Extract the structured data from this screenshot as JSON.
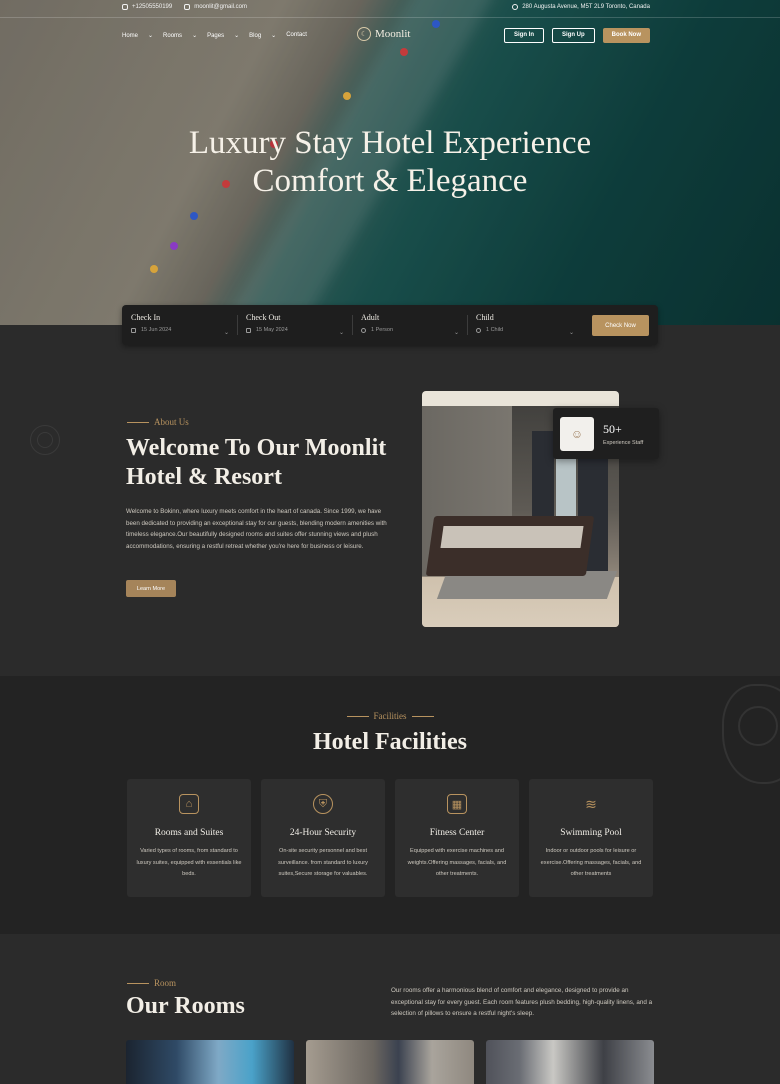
{
  "topbar": {
    "phone": "+12505550199",
    "email": "moonlit@gmail.com",
    "address": "280 Augusta Avenue, M5T 2L9 Toronto, Canada"
  },
  "nav": {
    "items": [
      "Home",
      "Rooms",
      "Pages",
      "Blog",
      "Contact"
    ],
    "logo": "Moonlit",
    "sign_in": "Sign In",
    "sign_up": "Sign Up",
    "book_now": "Book Now"
  },
  "hero": {
    "title_line1": "Luxury Stay Hotel Experience",
    "title_line2": "Comfort & Elegance"
  },
  "booking": {
    "check_in_label": "Check In",
    "check_in_value": "15 Jun 2024",
    "check_out_label": "Check Out",
    "check_out_value": "15 May 2024",
    "adult_label": "Adult",
    "adult_value": "1 Person",
    "child_label": "Child",
    "child_value": "1 Child",
    "check_now": "Check Now"
  },
  "about": {
    "kicker": "About Us",
    "title_line1": "Welcome To Our Moonlit",
    "title_line2": "Hotel & Resort",
    "text": "Welcome to Bokinn, where luxury meets comfort in the heart of canada. Since 1999, we have been dedicated to providing an exceptional stay for our guests, blending modern amenities with timeless elegance.Our beautifully designed rooms and suites offer stunning views and plush accommodations, ensuring a restful retreat whether you're here for business or leisure.",
    "learn_more": "Learn More",
    "staff_count": "50+",
    "staff_label": "Experience Staff"
  },
  "facilities": {
    "kicker": "Facilities",
    "title": "Hotel Facilities",
    "cards": [
      {
        "icon": "bed-icon",
        "title": "Rooms and Suites",
        "text": "Varied types of rooms, from standard to luxury suites, equipped with essentials like beds."
      },
      {
        "icon": "security-icon",
        "title": "24-Hour Security",
        "text": "On-site security personnel and best surveillance. from standard to luxury suites,Secure storage for valuables."
      },
      {
        "icon": "fitness-icon",
        "title": "Fitness Center",
        "text": "Equipped with exercise machines and weights.Offering massages, facials, and other treatments."
      },
      {
        "icon": "swimming-icon",
        "title": "Swimming Pool",
        "text": "Indoor or outdoor pools for leisure or exercise.Offering massages, facials, and other treatments"
      }
    ]
  },
  "rooms": {
    "kicker": "Room",
    "title": "Our Rooms",
    "text": "Our rooms offer a harmonious blend of comfort and elegance, designed to provide an exceptional stay for every guest. Each room features plush bedding, high-quality linens, and a selection of pillows to ensure a restful night's sleep."
  },
  "colors": {
    "accent": "#b8935f",
    "background": "#2b2b2b",
    "facilities_bg": "#232323"
  }
}
